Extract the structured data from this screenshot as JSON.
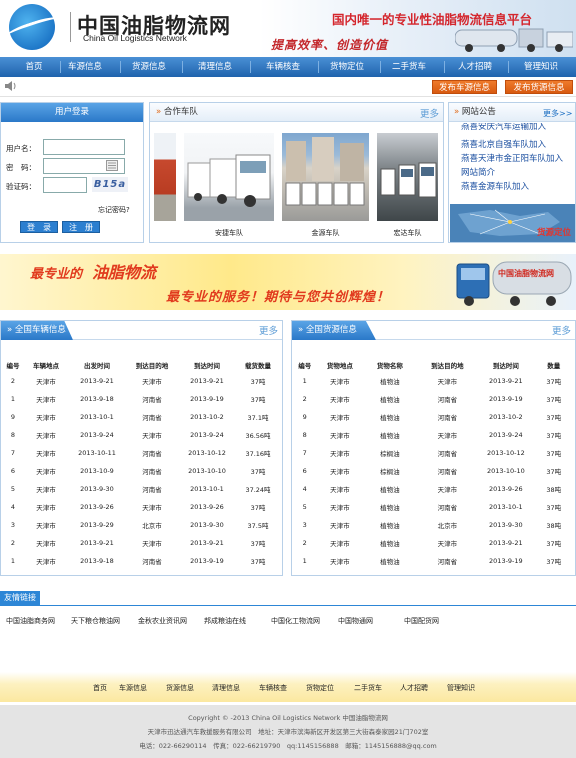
{
  "header": {
    "site_name_cn": "中国油脂物流网",
    "site_name_en": "China Oil Logistics Network",
    "slogan_main": "国内唯一的专业性油脂物流信息平台",
    "slogan_sub": "提高效率、创造价值"
  },
  "nav": [
    "首页",
    "车源信息",
    "货源信息",
    "清理信息",
    "车辆核查",
    "货物定位",
    "二手货车",
    "人才招聘",
    "管理知识"
  ],
  "subbar": {
    "publish_vehicle": "发布车源信息",
    "publish_cargo": "发布货源信息"
  },
  "login": {
    "title": "用户登录",
    "username_label": "用户名：",
    "password_label": "密　码：",
    "captcha_label": "验证码：",
    "captcha_text": "B15a",
    "forgot": "忘记密码?",
    "login_btn": "登　录",
    "register_btn": "注　册"
  },
  "fleet": {
    "title": "合作车队",
    "more": "更多",
    "captions": [
      "安捷车队",
      "金源车队",
      "宏达车队"
    ]
  },
  "notice": {
    "title": "网站公告",
    "more": "更多>>",
    "items": [
      "燕喜安庆汽车运输加入",
      "燕喜北京自强车队加入",
      "燕喜天津市金正阳车队加入",
      "网站简介",
      "燕喜金源车队加入"
    ],
    "map_label": "货源定位"
  },
  "banner": {
    "line1_a": "最专业的",
    "line1_b": "油脂物流",
    "line2": "最专业的服务！期待与您共创辉煌！",
    "truck_text": "中国油脂物流网"
  },
  "vehicles": {
    "title": "全国车辆信息",
    "more": "更多",
    "headers": [
      "编号",
      "车辆地点",
      "出发时间",
      "到达目的地",
      "到达时间",
      "载货数量"
    ],
    "rows": [
      [
        "2",
        "天津市",
        "2013-9-21",
        "天津市",
        "2013-9-21",
        "37吨"
      ],
      [
        "1",
        "天津市",
        "2013-9-18",
        "河南省",
        "2013-9-19",
        "37吨"
      ],
      [
        "9",
        "天津市",
        "2013-10-1",
        "河南省",
        "2013-10-2",
        "37.1吨"
      ],
      [
        "8",
        "天津市",
        "2013-9-24",
        "天津市",
        "2013-9-24",
        "36.56吨"
      ],
      [
        "7",
        "天津市",
        "2013-10-11",
        "河南省",
        "2013-10-12",
        "37.16吨"
      ],
      [
        "6",
        "天津市",
        "2013-10-9",
        "河南省",
        "2013-10-10",
        "37吨"
      ],
      [
        "5",
        "天津市",
        "2013-9-30",
        "河南省",
        "2013-10-1",
        "37.24吨"
      ],
      [
        "4",
        "天津市",
        "2013-9-26",
        "天津市",
        "2013-9-26",
        "37吨"
      ],
      [
        "3",
        "天津市",
        "2013-9-29",
        "北京市",
        "2013-9-30",
        "37.5吨"
      ],
      [
        "2",
        "天津市",
        "2013-9-21",
        "天津市",
        "2013-9-21",
        "37吨"
      ],
      [
        "1",
        "天津市",
        "2013-9-18",
        "河南省",
        "2013-9-19",
        "37吨"
      ]
    ]
  },
  "cargo": {
    "title": "全国货源信息",
    "more": "更多",
    "headers": [
      "编号",
      "货物地点",
      "货物名称",
      "到达目的地",
      "到达时间",
      "数量"
    ],
    "rows": [
      [
        "1",
        "天津市",
        "植物油",
        "天津市",
        "2013-9-21",
        "37吨"
      ],
      [
        "2",
        "天津市",
        "植物油",
        "河南省",
        "2013-9-19",
        "37吨"
      ],
      [
        "9",
        "天津市",
        "植物油",
        "河南省",
        "2013-10-2",
        "37吨"
      ],
      [
        "8",
        "天津市",
        "植物油",
        "天津市",
        "2013-9-24",
        "37吨"
      ],
      [
        "7",
        "天津市",
        "棕榈油",
        "河南省",
        "2013-10-12",
        "37吨"
      ],
      [
        "6",
        "天津市",
        "棕榈油",
        "河南省",
        "2013-10-10",
        "37吨"
      ],
      [
        "4",
        "天津市",
        "植物油",
        "天津市",
        "2013-9-26",
        "38吨"
      ],
      [
        "5",
        "天津市",
        "植物油",
        "河南省",
        "2013-10-1",
        "37吨"
      ],
      [
        "3",
        "天津市",
        "植物油",
        "北京市",
        "2013-9-30",
        "38吨"
      ],
      [
        "2",
        "天津市",
        "植物油",
        "天津市",
        "2013-9-21",
        "37吨"
      ],
      [
        "1",
        "天津市",
        "植物油",
        "河南省",
        "2013-9-19",
        "37吨"
      ]
    ]
  },
  "friend_links": {
    "title": "友情链接",
    "items": [
      "中国油脂商务网",
      "天下粮仓粮油网",
      "金秋农业资讯网",
      "邦成粮油在线",
      "中国化工物流网",
      "中国物通网",
      "中国配货网"
    ]
  },
  "footer": {
    "nav": [
      "首页",
      "车源信息",
      "货源信息",
      "清理信息",
      "车辆核查",
      "货物定位",
      "二手货车",
      "人才招聘",
      "管理知识"
    ],
    "copyright": "Copyright © -2013 China Oil Logistics Network 中国油脂物流网",
    "company": "天津市迅达通汽车救援服务有限公司　地址：天津市滨海新区开发区第三大街森泰家园21门702室",
    "contact": "电话：022-66290114　传真：022-66219790　qq:1145156888　邮箱：1145156888@qq.com"
  }
}
